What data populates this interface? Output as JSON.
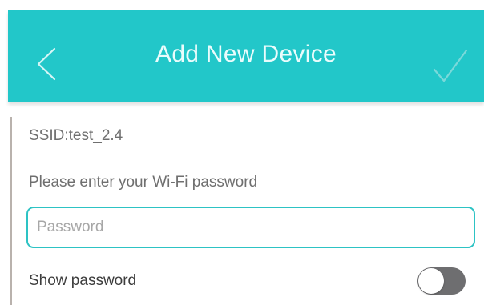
{
  "header": {
    "title": "Add New Device",
    "back_icon": "chevron-left-icon",
    "confirm_icon": "checkmark-icon",
    "background_color": "#22c7c9"
  },
  "form": {
    "ssid_text": "SSID:test_2.4",
    "prompt_text": "Please enter your Wi-Fi password",
    "password_value": "",
    "password_placeholder": "Password",
    "show_password_label": "Show password",
    "show_password_on": false,
    "input_border_color": "#2dc3c4"
  }
}
